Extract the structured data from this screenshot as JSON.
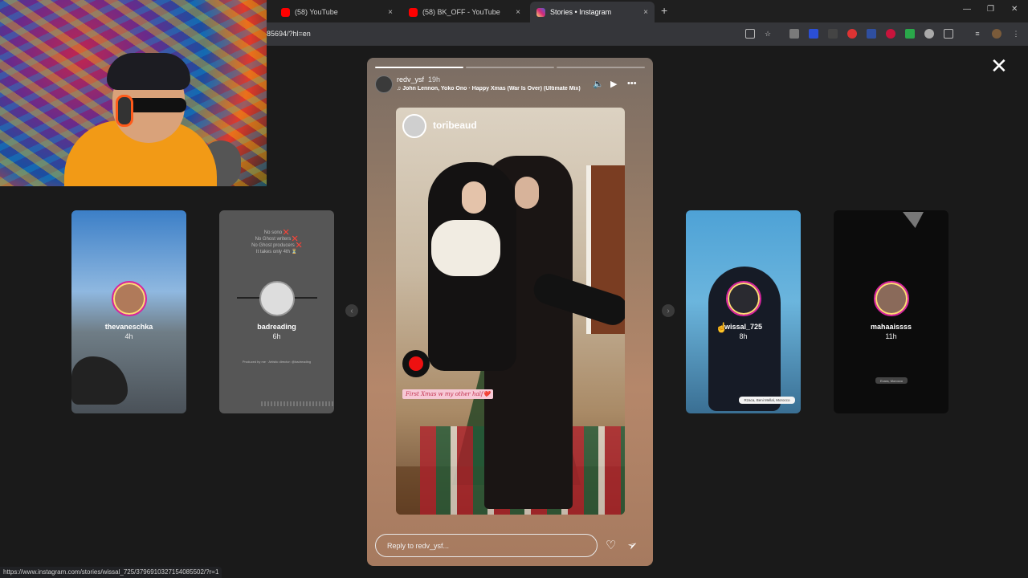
{
  "browser": {
    "tabs": [
      {
        "label": "(58) YouTube",
        "icon": "youtube-icon"
      },
      {
        "label": "(58) BK_OFF - YouTube",
        "icon": "youtube-icon"
      },
      {
        "label": "Stories • Instagram",
        "icon": "instagram-icon"
      }
    ],
    "close_glyph": "×",
    "new_tab_glyph": "+",
    "url": "85694/?hl=en",
    "window_controls": [
      "—",
      "❐",
      "✕"
    ],
    "status_url": "https://www.instagram.com/stories/wissal_725/3796910327154085502/?r=1"
  },
  "story": {
    "username": "redv_ysf",
    "time": "19h",
    "song": "♫ John Lennon, Yoko Ono · Happy Xmas (War Is Over) (Ultimate Mix)",
    "mute_glyph": "🔈",
    "play_glyph": "▶",
    "more_glyph": "•••",
    "tagged_user": "toribeaud",
    "caption": "First Xmas w my other half❤️",
    "reply_placeholder": "Reply to redv_ysf...",
    "like_glyph": "♡",
    "share_glyph": "➢",
    "segments_total": 3,
    "segments_done": 1
  },
  "side_stories": [
    {
      "username": "thevaneschka",
      "time": "4h"
    },
    {
      "username": "badreading",
      "time": "6h",
      "notes": [
        "No sono ❌",
        "No Ghost writers ❌",
        "No Ghost producers ❌",
        "It takes only 4th ⏳"
      ],
      "credits": "Produced by me · Artistic director: @badreading"
    },
    {
      "username": "wissal_725",
      "time": "8h",
      "location": "Rzaca, Beni Mellal, Morocco"
    },
    {
      "username": "mahaaissss",
      "time": "11h",
      "location": "Evara, Morocco"
    }
  ],
  "controls": {
    "close_glyph": "✕",
    "prev_glyph": "‹",
    "next_glyph": "›"
  }
}
